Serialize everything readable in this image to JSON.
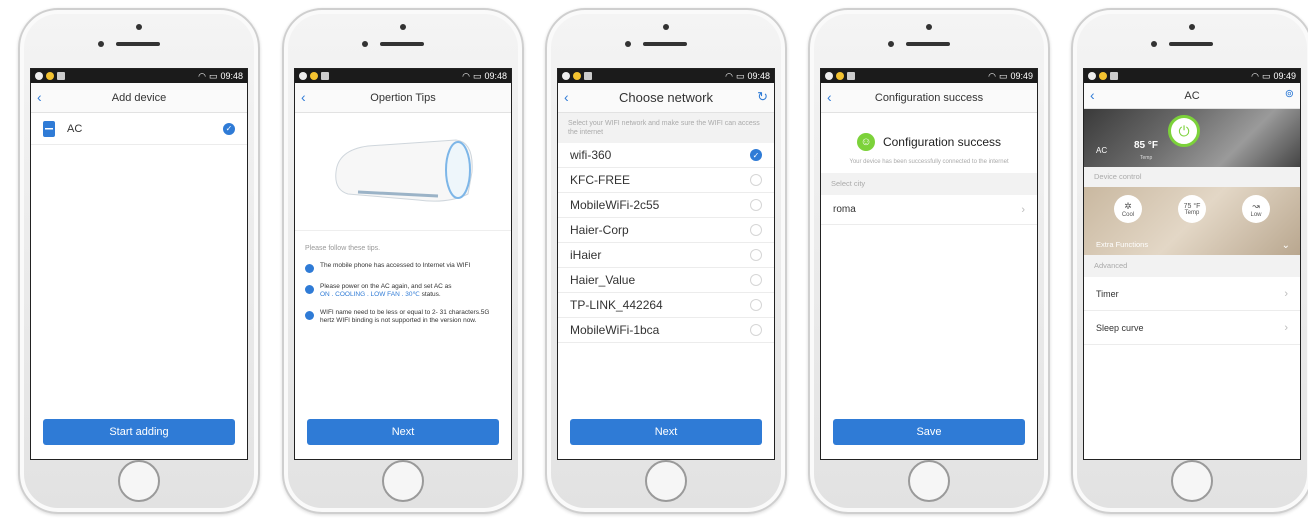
{
  "status": {
    "times": [
      "09:48",
      "09:48",
      "09:48",
      "09:49",
      "09:49"
    ]
  },
  "screen1": {
    "title": "Add device",
    "device": "AC",
    "button": "Start adding"
  },
  "screen2": {
    "title": "Opertion Tips",
    "intro": "Please follow these tips.",
    "tip1": "The mobile phone has accessed to Internet via WIFI",
    "tip2_prefix": "Please power on the AC again, and set AC as",
    "tip2_modes": "ON . COOLING . LOW FAN . 30℃",
    "tip2_suffix": "status.",
    "tip3": "WIFI name need to be less or equal to 2- 31 characters.5G hertz WIFI binding is not supported in the version now.",
    "button": "Next"
  },
  "screen3": {
    "title": "Choose network",
    "hint": "Select your WIFI network and make sure the WIFI can access the internet",
    "networks": [
      "wifi-360",
      "KFC-FREE",
      "MobileWiFi-2c55",
      "Haier-Corp",
      "iHaier",
      "Haier_Value",
      "TP-LINK_442264",
      "MobileWiFi-1bca"
    ],
    "button": "Next"
  },
  "screen4": {
    "title": "Configuration success",
    "heading": "Configuration success",
    "sub": "Your device has been successfully connected to the internet",
    "section": "Select city",
    "city": "roma",
    "button": "Save"
  },
  "screen5": {
    "title": "AC",
    "device_label": "AC",
    "temp": "85 °F",
    "temp_sub": "Temp",
    "section_control": "Device control",
    "ctrl_mode": "Cool",
    "ctrl_temp": "75 °F",
    "ctrl_temp_sub": "Temp",
    "ctrl_fan": "Low",
    "extra": "Extra Functions",
    "section_adv": "Advanced",
    "timer": "Timer",
    "sleep": "Sleep curve"
  },
  "colors": {
    "accent": "#2f7bd6",
    "success": "#7cd23a"
  }
}
